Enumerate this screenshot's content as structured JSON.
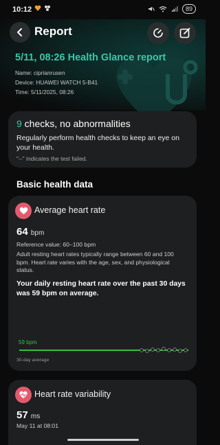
{
  "status_bar": {
    "time": "10:12",
    "battery": "89"
  },
  "header": {
    "title": "Report"
  },
  "report": {
    "title": "5/11, 08:26 Health Glance report",
    "name": "Name: ciprianrusen",
    "device": "Device: HUAWEI WATCH 5-B41",
    "time": "Time: 5/11/2025, 08:26"
  },
  "checks": {
    "count": "9",
    "title_rest": " checks, no abnormalities",
    "description": "Regularly perform health checks to keep an eye on your health.",
    "note": "\"--\" indicates the test failed."
  },
  "section": {
    "title": "Basic health data"
  },
  "heart_rate": {
    "title": "Average heart rate",
    "value": "64",
    "unit": "bpm",
    "reference": "Reference value: 60–100 bpm",
    "explanation": "Adult resting heart rates typically range between 60 and 100 bpm. Heart rate varies with the age, sex, and physiological status.",
    "daily_summary": "Your daily resting heart rate over the past 30 days was 59 bpm on average.",
    "chart_label": "59 bpm",
    "chart_caption": "30-day average",
    "colors": {
      "line": "#35c23b",
      "badge": "#e35a6e"
    }
  },
  "hrv": {
    "title": "Heart rate variability",
    "value": "57",
    "unit": "ms",
    "time": "May 11 at 08:01"
  },
  "colors": {
    "accent": "#35c9a9",
    "card": "#1e1f20",
    "background": "#0b0b0c"
  }
}
